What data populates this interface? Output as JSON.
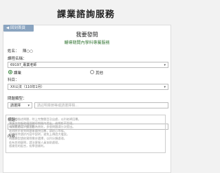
{
  "page": {
    "title": "課業諮詢服務"
  },
  "back_button": {
    "label": "◀ 回到首頁"
  },
  "card": {
    "title": "我要發問",
    "subtitle": "輔導期間內學科專屬服務"
  },
  "form": {
    "name": {
      "label": "姓名：",
      "value": "陳○○"
    },
    "class": {
      "label": "課程名稱：",
      "value": "69197_專業老師"
    },
    "type_options": [
      {
        "label": "課業",
        "checked": true
      },
      {
        "label": "其他",
        "checked": false
      }
    ],
    "subject": {
      "label": "科目：",
      "value": "XX公法（110年1月）"
    },
    "question_type": {
      "label": "問題類型：",
      "select_value": "請選擇",
      "placeholder": "請註明章節等或請選擇相…"
    },
    "title": {
      "label": "標題：",
      "placeholder": "請簡述您的問題"
    },
    "content": {
      "label": "內容："
    },
    "notes": [
      "請詳細描述問題，附上完整題目及出處，以利老師回覆。",
      "課業諮詢服務僅限輔導期間內提出，逾期恕不受理。",
      "每次提問以一個主題為原則，多個問題請分次提出。",
      "老師將於收到問題後盡快回覆，請耐心等候。",
      "如需附件請於內容中說明，避免上傳過大檔案。",
      "問題類型請依實際需求選擇，以利分類處理。",
      "若有其他疑問，請洽客服人員協助處理。",
      "感謝您的配合，祝學習順利。"
    ]
  },
  "colors": {
    "accent": "#2e7d32",
    "back_button_bg": "#8aa4c0"
  }
}
